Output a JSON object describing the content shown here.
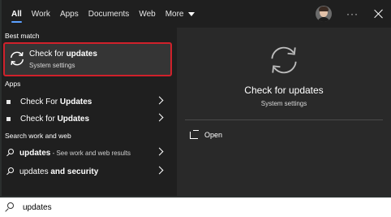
{
  "tabs": [
    "All",
    "Work",
    "Apps",
    "Documents",
    "Web",
    "More"
  ],
  "active_tab": "All",
  "icons": {
    "refresh": "refresh-icon",
    "search": "search-icon",
    "close": "close-icon",
    "more": "more-options-icon",
    "open": "open-icon",
    "chevron": "chevron-right-icon"
  },
  "colors": {
    "accent": "#5ba0ff",
    "highlight_border": "#d0212b"
  },
  "left": {
    "best_match_header": "Best match",
    "best_match": {
      "title_prefix": "Check for ",
      "title_bold": "updates",
      "subtitle": "System settings"
    },
    "apps_header": "Apps",
    "apps": [
      {
        "prefix": "Check For ",
        "bold": "Updates"
      },
      {
        "prefix": "Check for ",
        "bold": "Updates"
      }
    ],
    "web_header": "Search work and web",
    "web": [
      {
        "bold": "updates",
        "suffix": " - See work and web results"
      },
      {
        "prefix": "updates ",
        "bold": "and security"
      }
    ]
  },
  "right": {
    "title": "Check for updates",
    "subtitle": "System settings",
    "open_label": "Open"
  },
  "search": {
    "value": "updates"
  }
}
